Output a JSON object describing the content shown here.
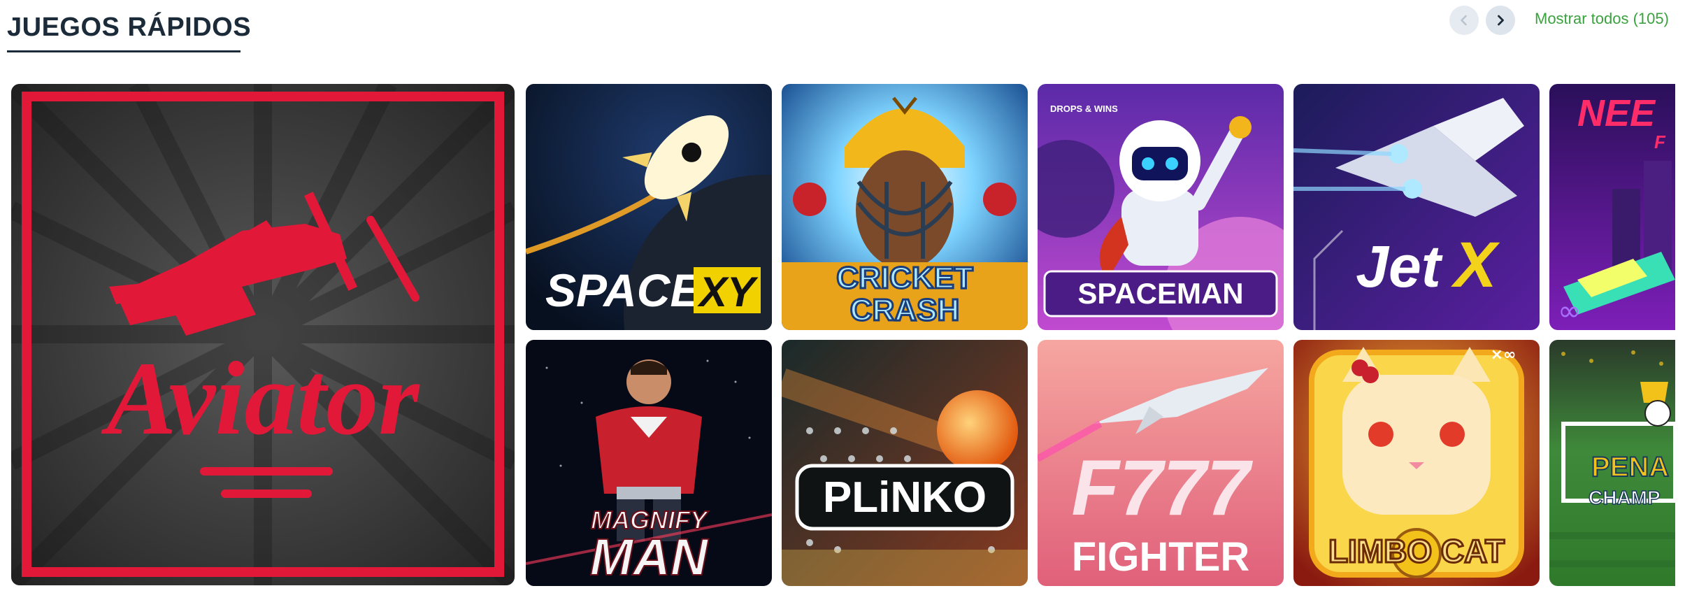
{
  "section": {
    "title": "JUEGOS RÁPIDOS",
    "show_all": "Mostrar todos (105)",
    "prev_icon": "chevron-left-icon",
    "next_icon": "chevron-right-icon"
  },
  "colors": {
    "title": "#1c2b39",
    "show_all": "#3aa23f",
    "aviator_red": "#e11838"
  },
  "games": [
    {
      "id": "aviator",
      "label": "Aviator"
    },
    {
      "id": "space-xy",
      "label_a": "SPACE",
      "label_b": "XY"
    },
    {
      "id": "cricket-crash",
      "label_a": "CRICKET",
      "label_b": "CRASH"
    },
    {
      "id": "spaceman",
      "label": "SPACEMAN",
      "badge": "DROPS & WINS"
    },
    {
      "id": "jetx",
      "label_a": "Jet",
      "label_b": "X"
    },
    {
      "id": "need-for-x",
      "label": "NEE",
      "sub": "F"
    },
    {
      "id": "magnify-man",
      "label_a": "MAGNIFY",
      "label_b": "MAN"
    },
    {
      "id": "plinko",
      "label": "PLiNKO"
    },
    {
      "id": "f777-fighter",
      "label_a": "F777",
      "label_b": "FIGHTER"
    },
    {
      "id": "limbo-cat",
      "label": "LIMBO CAT",
      "badge": "×∞"
    },
    {
      "id": "penalty-champion",
      "label_a": "PENA",
      "label_b": "CHAMP"
    }
  ]
}
